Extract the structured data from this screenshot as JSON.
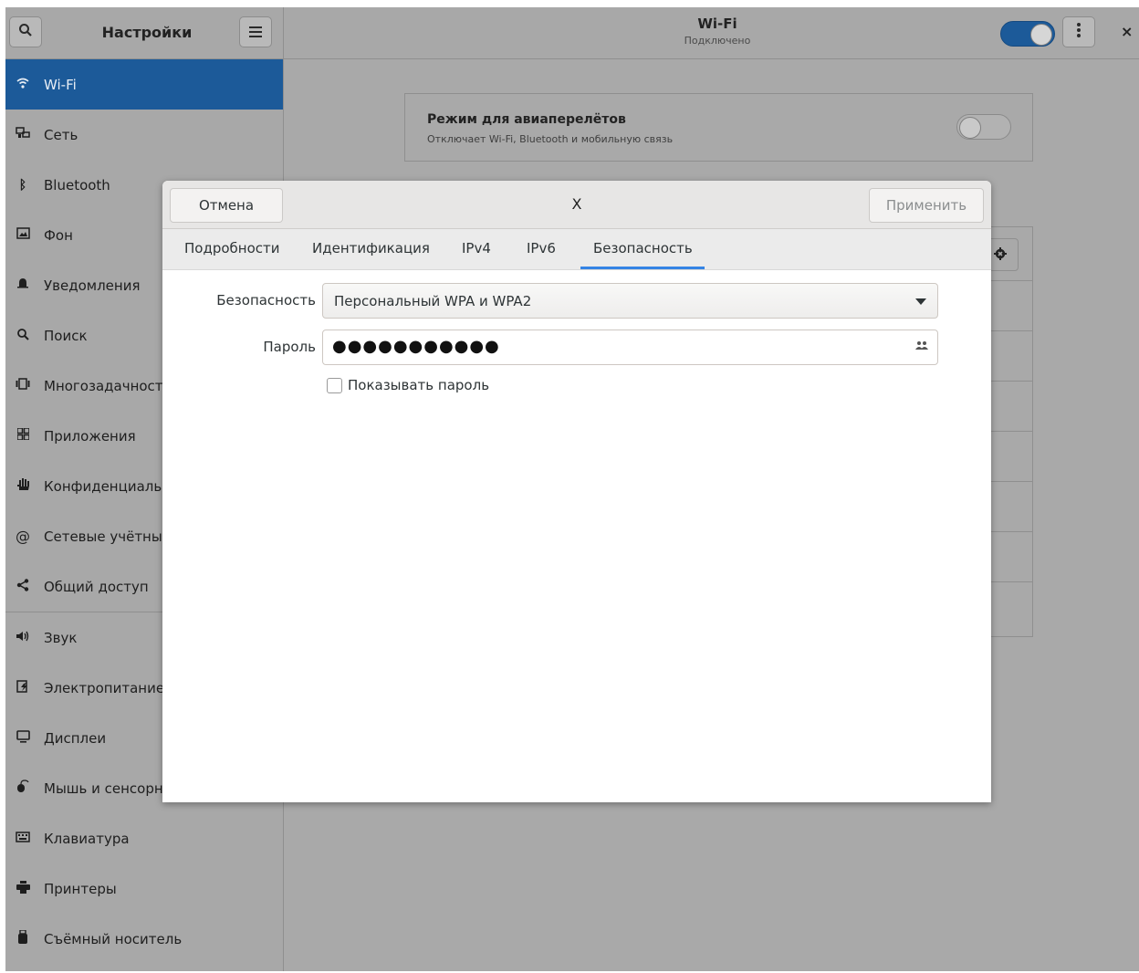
{
  "header": {
    "search_icon": "search-icon",
    "app_title": "Настройки",
    "menu_icon": "hamburger-menu-icon",
    "wifi_title": "Wi-Fi",
    "wifi_subtitle": "Подключено",
    "wifi_toggle_on": true,
    "more_icon": "vertical-dots-icon",
    "close_label": "×",
    "accent_color": "#1c5a99"
  },
  "sidebar": {
    "items": [
      {
        "label": "Wi-Fi",
        "icon": "wifi-icon",
        "active": true
      },
      {
        "label": "Сеть",
        "icon": "network-icon"
      },
      {
        "label": "Bluetooth",
        "icon": "bluetooth-icon"
      },
      {
        "label": "Фон",
        "icon": "background-icon"
      },
      {
        "label": "Уведомления",
        "icon": "bell-icon"
      },
      {
        "label": "Поиск",
        "icon": "search-icon"
      },
      {
        "label": "Многозадачност",
        "icon": "multitasking-icon"
      },
      {
        "label": "Приложения",
        "icon": "apps-grid-icon"
      },
      {
        "label": "Конфиденциальн",
        "icon": "hand-icon"
      },
      {
        "label": "Сетевые учётные",
        "icon": "at-sign-icon"
      },
      {
        "label": "Общий доступ",
        "icon": "share-icon"
      },
      {
        "label": "Звук",
        "icon": "speaker-icon"
      },
      {
        "label": "Электропитание",
        "icon": "power-icon"
      },
      {
        "label": "Дисплеи",
        "icon": "display-icon"
      },
      {
        "label": "Мышь и сенсорн",
        "icon": "mouse-icon"
      },
      {
        "label": "Клавиатура",
        "icon": "keyboard-icon"
      },
      {
        "label": "Принтеры",
        "icon": "printer-icon"
      },
      {
        "label": "Съёмный носитель",
        "icon": "usb-icon"
      }
    ]
  },
  "airplane": {
    "title": "Режим для авиаперелётов",
    "subtitle": "Отключает Wi-Fi, Bluetooth и мобильную связь",
    "toggle_on": false
  },
  "dialog": {
    "cancel_label": "Отмена",
    "title": "X",
    "apply_label": "Применить",
    "tabs": [
      {
        "label": "Подробности"
      },
      {
        "label": "Идентификация"
      },
      {
        "label": "IPv4"
      },
      {
        "label": "IPv6"
      },
      {
        "label": "Безопасность",
        "active": true
      }
    ],
    "security_label": "Безопасность",
    "security_value": "Персональный WPA и WPA2",
    "password_label": "Пароль",
    "password_value": "●●●●●●●●●●●",
    "password_icon": "users-icon",
    "show_password_label": "Показывать пароль",
    "show_password_checked": false
  }
}
